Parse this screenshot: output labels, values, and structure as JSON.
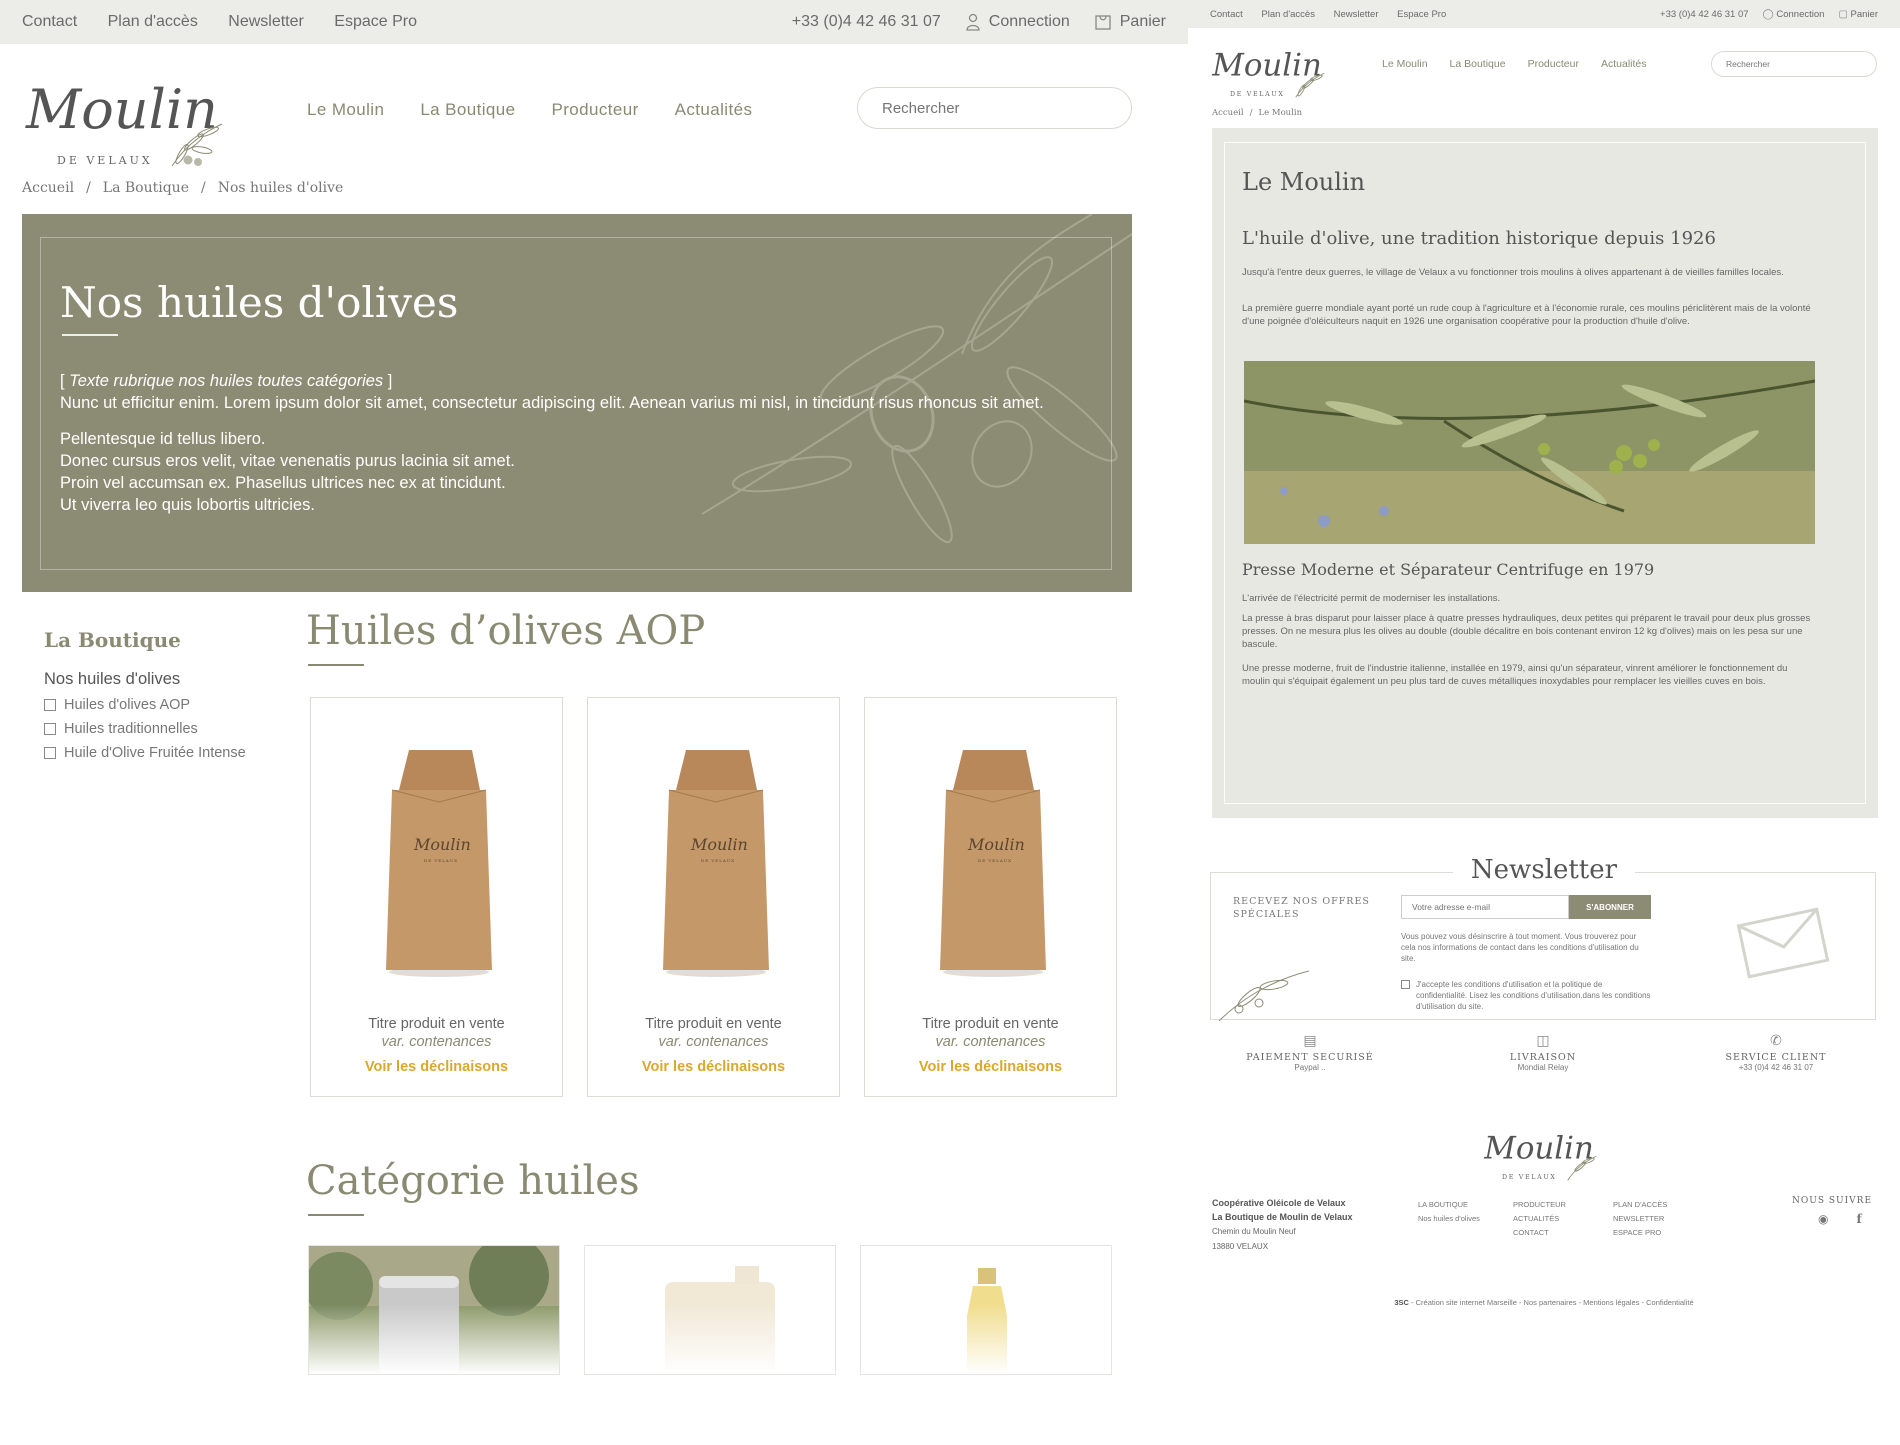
{
  "left": {
    "topbar": {
      "links": [
        "Contact",
        "Plan d'accès",
        "Newsletter",
        "Espace Pro"
      ],
      "phone": "+33 (0)4 42 46 31 07",
      "connection": "Connection",
      "cart": "Panier"
    },
    "logo": {
      "script": "Moulin",
      "sub": "DE VELAUX"
    },
    "nav": [
      "Le Moulin",
      "La Boutique",
      "Producteur",
      "Actualités"
    ],
    "search": {
      "placeholder": "Rechercher"
    },
    "breadcrumb": [
      "Accueil",
      "La Boutique",
      "Nos huiles d'olive"
    ],
    "hero": {
      "title": "Nos huiles d'olives",
      "intro_bracket_open": "[ ",
      "intro_italic": "Texte rubrique nos huiles toutes catégories",
      "intro_bracket_close": " ]",
      "para1": "Nunc ut efficitur enim. Lorem ipsum dolor sit amet, consectetur adipiscing elit. Aenean varius mi nisl, in tincidunt risus rhoncus sit amet.",
      "lines": [
        "Pellentesque id tellus libero.",
        "Donec cursus eros velit, vitae venenatis purus lacinia sit amet.",
        "Proin vel accumsan ex. Phasellus ultrices nec ex at tincidunt.",
        "Ut viverra leo quis lobortis ultricies."
      ]
    },
    "sidebar": {
      "title": "La Boutique",
      "subtitle": "Nos huiles d'olives",
      "filters": [
        "Huiles d'olives AOP",
        "Huiles traditionnelles",
        "Huile d'Olive Fruitée Intense"
      ]
    },
    "section_aop": "Huiles d’olives AOP",
    "products": [
      {
        "title": "Titre produit en vente",
        "variant": "var. contenances",
        "link": "Voir les déclinaisons"
      },
      {
        "title": "Titre produit en vente",
        "variant": "var. contenances",
        "link": "Voir les déclinaisons"
      },
      {
        "title": "Titre produit en vente",
        "variant": "var. contenances",
        "link": "Voir les déclinaisons"
      }
    ],
    "section_categories": "Catégorie huiles"
  },
  "right": {
    "topbar": {
      "links": [
        "Contact",
        "Plan d'accès",
        "Newsletter",
        "Espace Pro"
      ],
      "phone": "+33 (0)4 42 46 31 07",
      "connection": "Connection",
      "cart": "Panier"
    },
    "logo": {
      "script": "Moulin",
      "sub": "DE VELAUX"
    },
    "nav": [
      "Le Moulin",
      "La Boutique",
      "Producteur",
      "Actualités"
    ],
    "search": {
      "placeholder": "Rechercher"
    },
    "breadcrumb": [
      "Accueil",
      "Le Moulin"
    ],
    "panel": {
      "title": "Le Moulin",
      "subtitle": "L'huile d'olive, une tradition historique depuis 1926",
      "p1": "Jusqu'à l'entre deux guerres, le village de Velaux a vu fonctionner trois moulins à olives appartenant à de vieilles familles locales.",
      "p2": "La première guerre mondiale ayant porté un rude coup à l'agriculture et à l'économie rurale, ces moulins périclitèrent mais de la volonté d'une poignée d'oléiculteurs naquit en 1926 une organisation coopérative pour la production d'huile d'olive.",
      "subtitle2": "Presse Moderne et Séparateur Centrifuge en 1979",
      "p3": "L'arrivée de l'électricité permit de moderniser les installations.",
      "p4": "La presse à bras disparut pour laisser place à quatre presses hydrauliques, deux petites qui préparent le travail pour deux plus grosses presses. On ne mesura plus les olives au double (double décalitre en bois contenant environ 12 kg d'olives) mais on les pesa sur une bascule.",
      "p5": "Une presse moderne, fruit de l'industrie italienne, installée en 1979, ainsi qu'un séparateur, vinrent améliorer le fonctionnement du moulin qui s'équipait également un peu plus tard de cuves métalliques inoxydables pour remplacer les vieilles cuves en bois."
    },
    "newsletter": {
      "title": "Newsletter",
      "offers": "RECEVEZ NOS OFFRES SPÉCIALES",
      "email_placeholder": "Votre adresse e-mail",
      "subscribe": "S'ABONNER",
      "info": "Vous pouvez vous désinscrire à tout moment. Vous trouverez pour cela nos informations de contact dans les conditions d'utilisation du site.",
      "consent": "J'accepte les conditions d'utilisation et la politique de confidentialité. Lisez les conditions d'utilisation.dans les conditions d'utilisation du site."
    },
    "features": [
      {
        "label": "PAIEMENT SECURISÉ",
        "sub": "Paypal ..",
        "icon": "lock-icon"
      },
      {
        "label": "LIVRAISON",
        "sub": "Mondial Relay",
        "icon": "box-icon"
      },
      {
        "label": "SERVICE CLIENT",
        "sub": "+33 (0)4 42 46 31 07",
        "icon": "phone-icon"
      }
    ],
    "footer": {
      "coop": "Coopérative Oléicole de Velaux",
      "boutique": "La Boutique de Moulin de Velaux",
      "address1": "Chemin du Moulin Neuf",
      "address2": "13880 VELAUX",
      "col1": [
        "LA BOUTIQUE",
        "Nos huiles d'olives"
      ],
      "col2": [
        "PRODUCTEUR",
        "ACTUALITÉS",
        "CONTACT"
      ],
      "col3": [
        "PLAN D'ACCÈS",
        "NEWSLETTER",
        "ESPACE PRO"
      ],
      "follow": "NOUS SUIVRE",
      "copyright_brand": "3SC",
      "copyright_rest": " - Création site internet Marseille - Nos partenaires - Mentions légales - Confidentialité"
    }
  },
  "colors": {
    "olive": "#8c8b73",
    "accent": "#d9a82d",
    "bar": "#ecece8",
    "panel": "#e8e8e3"
  }
}
